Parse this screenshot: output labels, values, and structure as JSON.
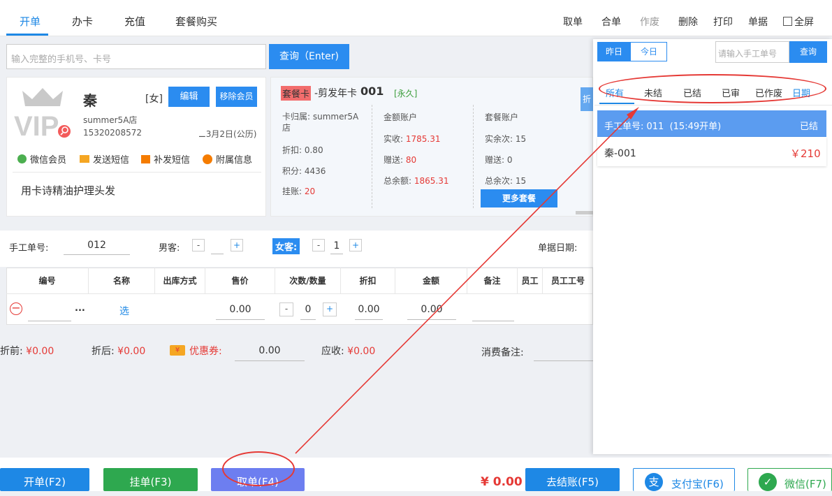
{
  "tabs": [
    "开单",
    "办卡",
    "充值",
    "套餐购买"
  ],
  "toolbar": {
    "take": "取单",
    "merge": "合单",
    "void": "作废",
    "delete": "删除",
    "print": "打印",
    "docs": "单据",
    "fullscreen": "全屏"
  },
  "search": {
    "placeholder": "输入完整的手机号、卡号",
    "button": "查询（Enter)"
  },
  "member": {
    "name": "秦",
    "gender": "[女]",
    "edit": "编辑",
    "remove": "移除会员",
    "store": "summer5A店",
    "phone": "15320208572",
    "birthday": "3月2日(公历)",
    "actions": [
      "微信会员",
      "发送短信",
      "补发短信",
      "附属信息"
    ],
    "note": "用卡诗精油护理头发"
  },
  "card": {
    "type_badge": "套餐卡",
    "name": "-剪发年卡",
    "number": "001",
    "validity": "[永久]",
    "col1": {
      "belongs": "卡归属: summer5A店",
      "discount": "折扣: 0.80",
      "points": "积分: 4436",
      "credit_label": "挂账:",
      "credit": "20"
    },
    "col2": {
      "title": "金额账户",
      "paid_label": "实收:",
      "paid": "1785.31",
      "gift_label": "赠送:",
      "gift": "80",
      "total_label": "总余额:",
      "total": "1865.31"
    },
    "col3": {
      "title": "套餐账户",
      "remain": "实余次: 15",
      "gift": "赠送: 0",
      "total": "总余次: 15",
      "more": "更多套餐"
    },
    "side_tab": "折"
  },
  "form": {
    "manual_no_label": "手工单号:",
    "manual_no": "012",
    "male_label": "男客:",
    "male_count": "",
    "female_label": "女客:",
    "female_count": "1",
    "date_label": "单据日期:"
  },
  "table": {
    "headers": [
      "编号",
      "名称",
      "出库方式",
      "售价",
      "次数/数量",
      "折扣",
      "金额",
      "备注",
      "员工",
      "员工工号"
    ],
    "row": {
      "select": "选",
      "price": "0.00",
      "qty": "0",
      "discount": "0.00",
      "amount": "0.00",
      "more": "..."
    }
  },
  "totals": {
    "before_label": "折前:",
    "before": "¥0.00",
    "after_label": "折后:",
    "after": "¥0.00",
    "coupon_label": "优惠券:",
    "coupon": "0.00",
    "due_label": "应收:",
    "due": "¥0.00",
    "remark_label": "消费备注:"
  },
  "panel": {
    "yesterday": "昨日",
    "today": "今日",
    "manual_placeholder": "请输入手工单号",
    "query": "查询",
    "filters": [
      "所有",
      "未结",
      "已结",
      "已审",
      "已作废",
      "日期"
    ],
    "order": {
      "header": "手工单号: 011  (15:49开单)",
      "status": "已结",
      "customer": "秦-001",
      "amount": "￥210"
    }
  },
  "bottom": {
    "open": "开单(F2)",
    "hold": "挂单(F3)",
    "take": "取单(F4)",
    "total": "¥ 0.00",
    "checkout": "去结账(F5)",
    "alipay": "支付宝(F6)",
    "wechat": "微信(F7)"
  }
}
